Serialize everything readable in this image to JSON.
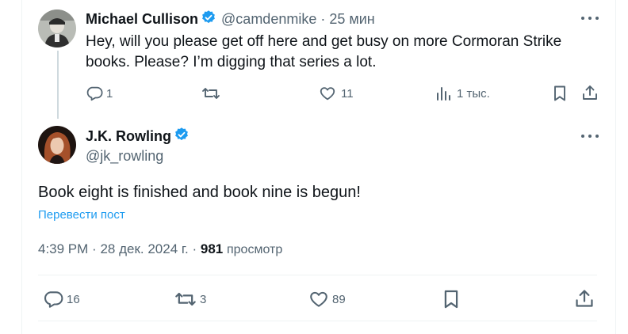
{
  "reply": {
    "name": "Michael Cullison",
    "handle": "@camdenmike",
    "separator": "·",
    "time": "25 мин",
    "text_line1": "Hey, will you please get off here and get busy on more Cormoran Strike",
    "text_line2": "books. Please? I’m digging that series a lot.",
    "replies": "1",
    "reposts": "",
    "likes": "11",
    "views": "1 тыс."
  },
  "main": {
    "name": "J.K. Rowling",
    "handle": "@jk_rowling",
    "text": "Book eight is finished and book nine is begun!",
    "translate": "Перевести пост",
    "time": "4:39 PM",
    "date": "28 дек. 2024 г.",
    "dot": "·",
    "views_count": "981",
    "views_label": "просмотр",
    "replies": "16",
    "reposts": "3",
    "likes": "89"
  },
  "icons": {
    "verified": "verified-badge-icon",
    "more": "more-dots-icon",
    "reply": "reply-bubble-icon",
    "repost": "repost-arrows-icon",
    "like": "heart-icon",
    "views": "views-bars-icon",
    "bookmark": "bookmark-icon",
    "share": "share-icon"
  },
  "colors": {
    "accent": "#1d9bf0",
    "text": "#0f1419",
    "muted": "#536471",
    "divider": "#eff3f4"
  }
}
